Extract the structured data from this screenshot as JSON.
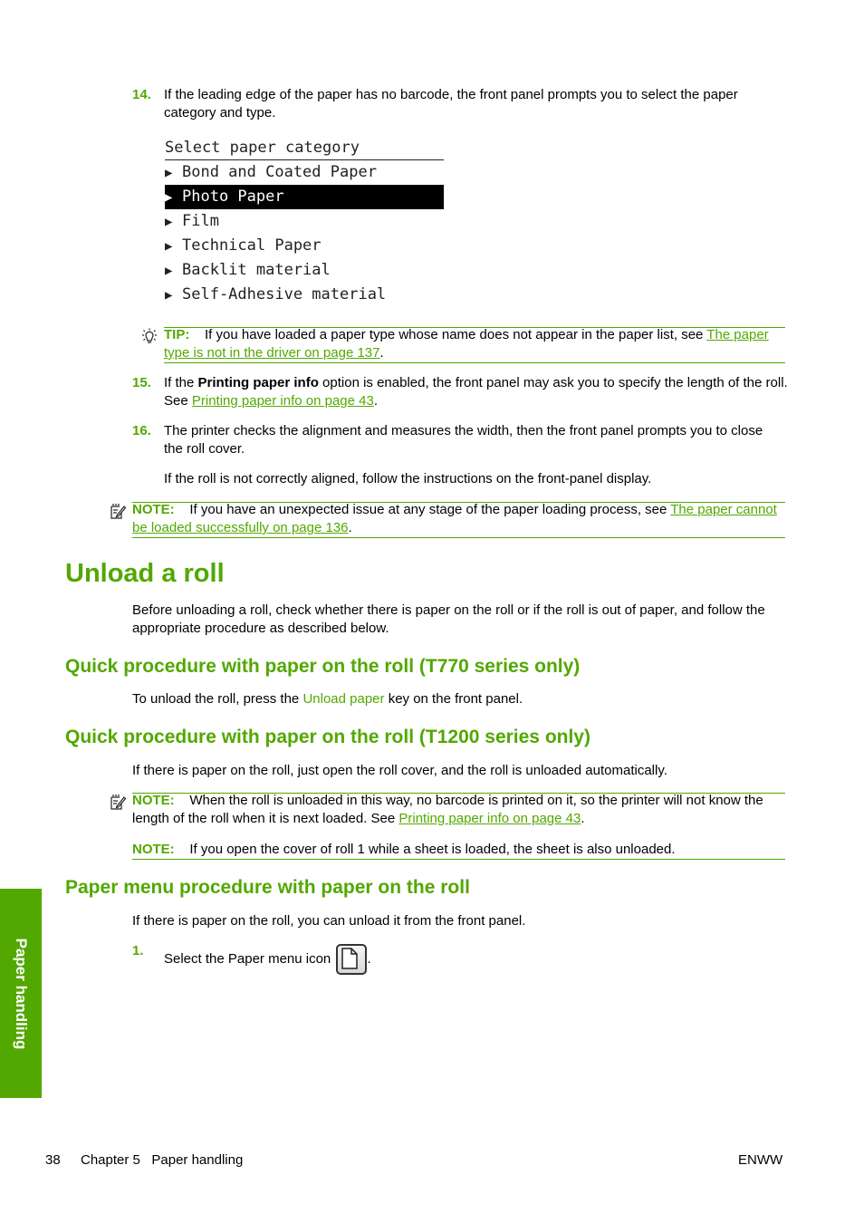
{
  "steps_top": [
    {
      "num": "14.",
      "text": "If the leading edge of the paper has no barcode, the front panel prompts you to select the paper category and type."
    },
    {
      "num": "15.",
      "text_before": "If the ",
      "bold": "Printing paper info",
      "text_after": " option is enabled, the front panel may ask you to specify the length of the roll. See ",
      "link": "Printing paper info on page 43",
      "end": "."
    },
    {
      "num": "16.",
      "text": "The printer checks the alignment and measures the width, then the front panel prompts you to close the roll cover.",
      "followup": "If the roll is not correctly aligned, follow the instructions on the front-panel display."
    }
  ],
  "front_panel": {
    "title": "Select paper category",
    "items": [
      {
        "label": "Bond and Coated Paper",
        "selected": false
      },
      {
        "label": "Photo Paper",
        "selected": true
      },
      {
        "label": "Film",
        "selected": false
      },
      {
        "label": "Technical Paper",
        "selected": false
      },
      {
        "label": "Backlit material",
        "selected": false
      },
      {
        "label": "Self-Adhesive material",
        "selected": false
      }
    ],
    "arrow": "▶"
  },
  "tip": {
    "icon": "lightbulb-icon",
    "label": "TIP:",
    "text": "If you have loaded a paper type whose name does not appear in the paper list, see ",
    "link": "The paper type is not in the driver on page 137",
    "end": "."
  },
  "note_loading": {
    "icon": "note-icon",
    "label": "NOTE:",
    "text": "If you have an unexpected issue at any stage of the paper loading process, see ",
    "link": "The paper cannot be loaded successfully on page 136",
    "end": "."
  },
  "section": {
    "title": "Unload a roll",
    "intro": "Before unloading a roll, check whether there is paper on the roll or if the roll is out of paper, and follow the appropriate procedure as described below."
  },
  "sub1": {
    "title": "Quick procedure with paper on the roll (T770 series only)",
    "text_before": "To unload the roll, press the ",
    "key": "Unload paper",
    "text_after": " key on the front panel."
  },
  "sub2": {
    "title": "Quick procedure with paper on the roll (T1200 series only)",
    "text": "If there is paper on the roll, just open the roll cover, and the roll is unloaded automatically.",
    "note1": {
      "label": "NOTE:",
      "text": "When the roll is unloaded in this way, no barcode is printed on it, so the printer will not know the length of the roll when it is next loaded. See ",
      "link": "Printing paper info on page 43",
      "end": "."
    },
    "note2": {
      "label": "NOTE:",
      "text": "If you open the cover of roll 1 while a sheet is loaded, the sheet is also unloaded."
    }
  },
  "sub3": {
    "title": "Paper menu procedure with paper on the roll",
    "text": "If there is paper on the roll, you can unload it from the front panel.",
    "step": {
      "num": "1.",
      "text": "Select the Paper menu icon",
      "end": "."
    }
  },
  "side_tab": "Paper handling",
  "footer": {
    "page": "38",
    "chapter": "Chapter 5   Paper handling",
    "right": "ENWW"
  }
}
